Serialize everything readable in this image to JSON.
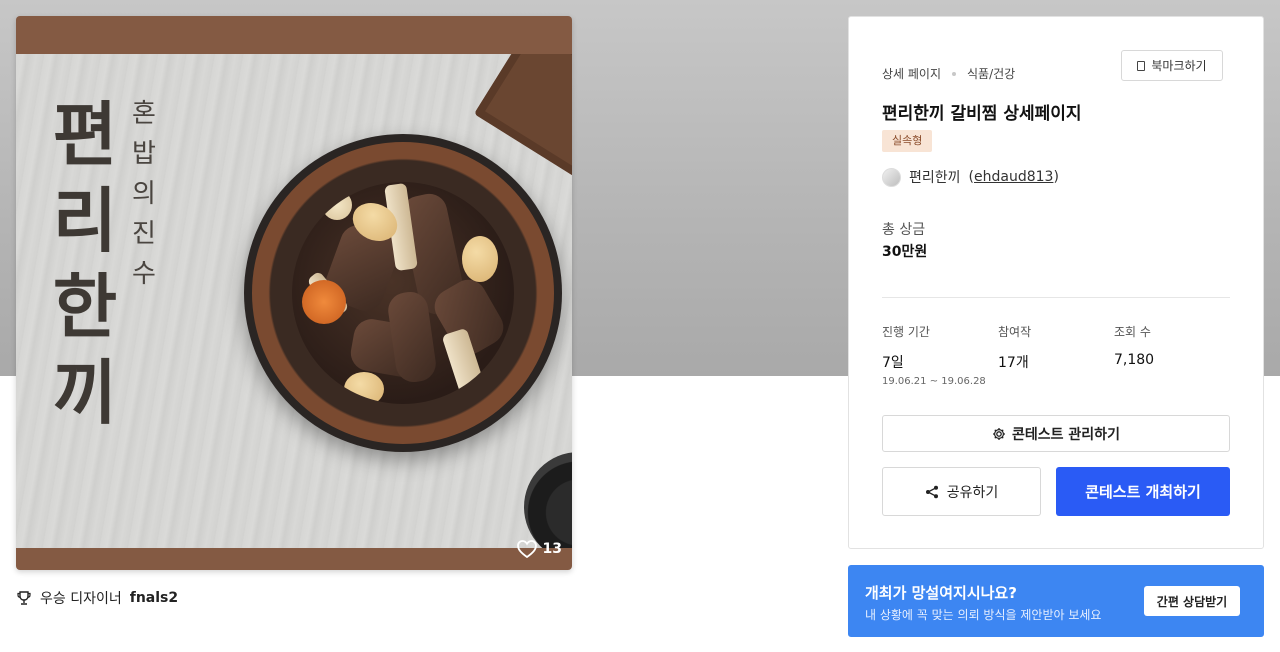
{
  "hero": {
    "title_chars": [
      "편",
      "리",
      "한",
      "끼"
    ],
    "subtitle_chars": [
      "혼",
      "밥",
      "의",
      "진",
      "수"
    ],
    "like_count": "13"
  },
  "winner": {
    "label": "우승 디자이너",
    "name": "fnals2"
  },
  "panel": {
    "breadcrumb": [
      "상세 페이지",
      "식품/건강"
    ],
    "bookmark_label": "북마크하기",
    "title": "편리한끼 갈비찜 상세페이지",
    "tag": "실속형",
    "author_name": "편리한끼",
    "author_id": "ehdaud813",
    "prize_label": "총 상금",
    "prize_value": "30만원",
    "stats": [
      {
        "label": "진행 기간",
        "value": "7일",
        "sub": "19.06.21 ~ 19.06.28"
      },
      {
        "label": "참여작",
        "value": "17개",
        "sub": ""
      },
      {
        "label": "조회 수",
        "value": "7,180",
        "sub": ""
      }
    ],
    "manage_label": "콘테스트 관리하기",
    "share_label": "공유하기",
    "host_label": "콘테스트 개최하기"
  },
  "promo": {
    "title": "개최가 망설여지시나요?",
    "desc": "내 상황에 꼭 맞는 의뢰 방식을 제안받아 보세요",
    "button": "간편 상담받기"
  },
  "colors": {
    "primary": "#2a5bf5",
    "promo": "#3d86f2",
    "frame": "#845a43",
    "tag_bg": "#f8e4d5"
  }
}
